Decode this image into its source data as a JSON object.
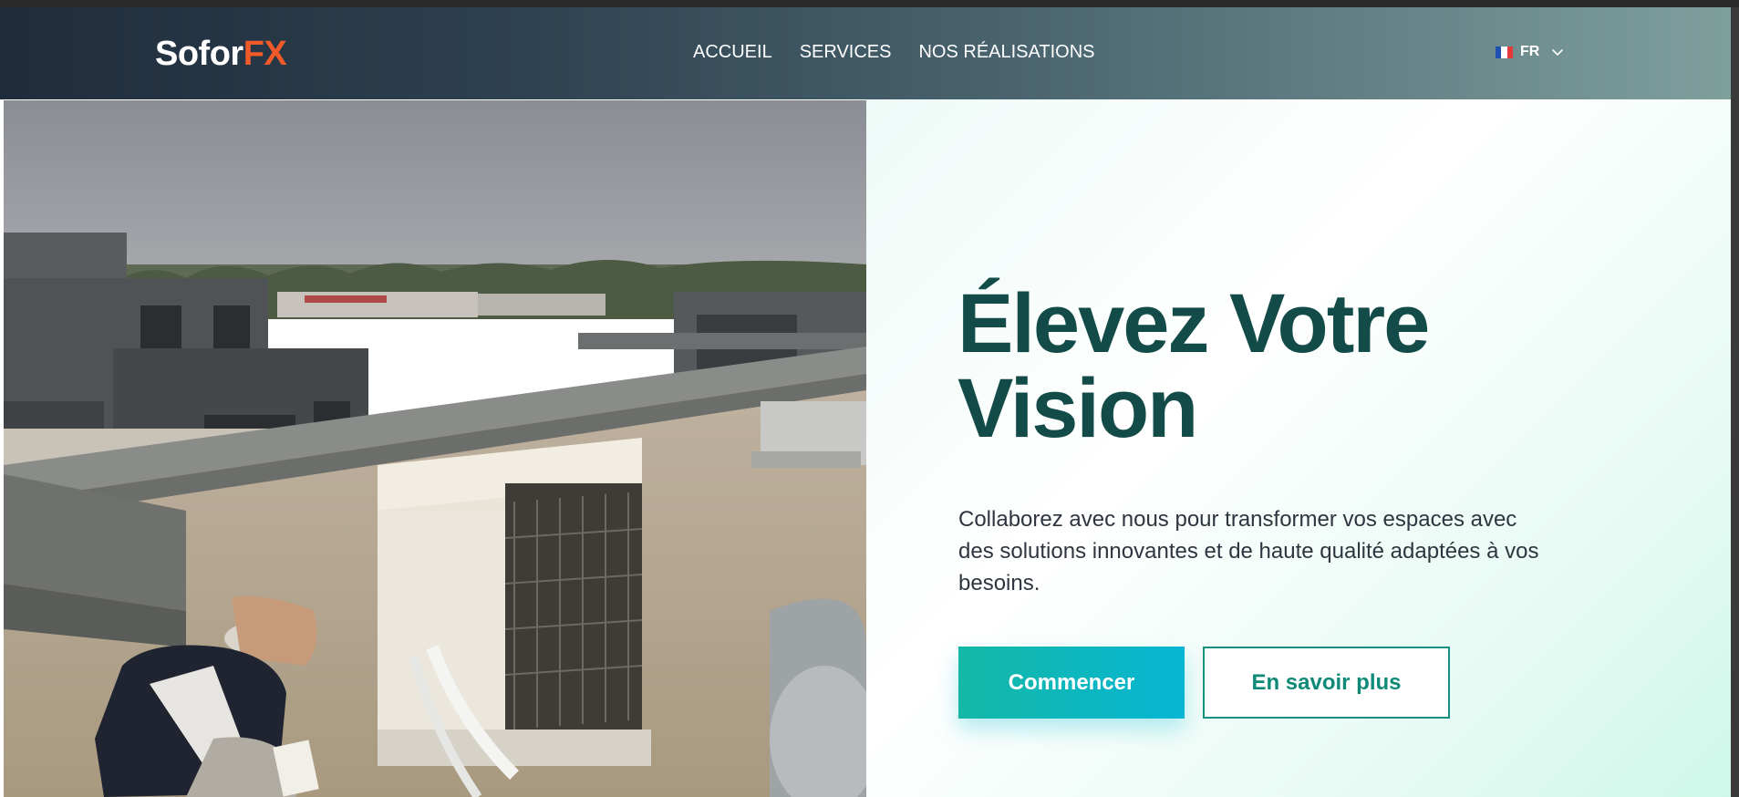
{
  "brand": {
    "logo_part1": "Sofor",
    "logo_part2": "FX",
    "accent_color": "#f05a28"
  },
  "nav": {
    "items": [
      {
        "label": "ACCUEIL"
      },
      {
        "label": "SERVICES"
      },
      {
        "label": "NOS RÉALISATIONS"
      }
    ]
  },
  "language": {
    "label": "FR",
    "flag_icon": "france-flag-icon",
    "chevron_icon": "chevron-down-icon"
  },
  "hero": {
    "image_alt_icon": "technician-rooftop-hvac-photo",
    "headline_line1": "Élevez Votre",
    "headline_line2": "Vision",
    "description": "Collaborez avec nous pour transformer vos espaces avec des solutions innovantes et de haute qualité adaptées à vos besoins.",
    "primary_button": "Commencer",
    "secondary_button": "En savoir plus",
    "headline_color": "#124b47",
    "primary_gradient": [
      "#15b8a6",
      "#06b6d4"
    ]
  }
}
